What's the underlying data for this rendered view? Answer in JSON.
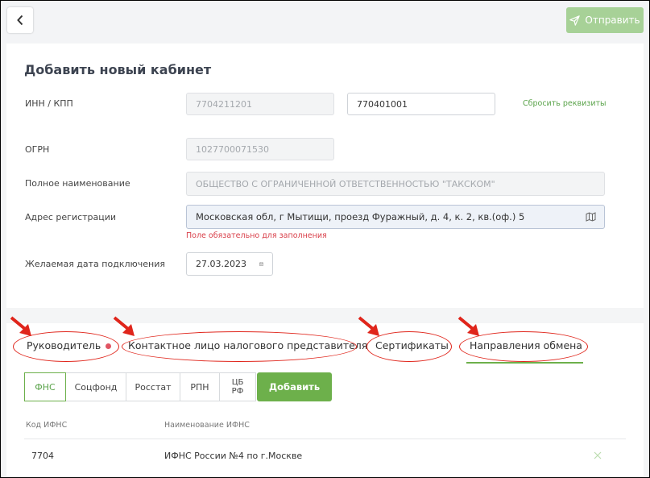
{
  "header": {
    "back_icon": "chevron-left-icon",
    "send_label": "Отправить",
    "send_icon": "paper-plane-icon"
  },
  "form": {
    "title": "Добавить новый кабинет",
    "inn_kpp": {
      "label": "ИНН / КПП",
      "inn_value": "7704211201",
      "kpp_value": "770401001"
    },
    "reset_link": "Сбросить реквизиты",
    "ogrn": {
      "label": "ОГРН",
      "value": "1027700071530"
    },
    "full_name": {
      "label": "Полное наименование",
      "value": "ОБЩЕСТВО С ОГРАНИЧЕННОЙ ОТВЕТСТВЕННОСТЬЮ \"ТАКСКОМ\""
    },
    "address": {
      "label": "Адрес регистрации",
      "value": "Московская обл, г Мытищи, проезд Фуражный, д. 4, к. 2, кв.(оф.) 5",
      "error": "Поле обязательно для заполнения",
      "icon": "map-icon"
    },
    "date": {
      "label": "Желаемая дата подключения",
      "value": "27.03.2023",
      "icon": "calendar-icon"
    }
  },
  "tabs": [
    {
      "label": "Руководитель",
      "has_dot": true
    },
    {
      "label": "Контактное лицо налогового представителя"
    },
    {
      "label": "Сертификаты"
    },
    {
      "label": "Направления обмена",
      "active": true
    }
  ],
  "sub_tabs": [
    {
      "label": "ФНС",
      "active": true
    },
    {
      "label": "Соцфонд"
    },
    {
      "label": "Росстат"
    },
    {
      "label": "РПН"
    },
    {
      "label_line1": "ЦБ",
      "label_line2": "РФ"
    }
  ],
  "add_button": "Добавить",
  "table": {
    "headers": [
      "Код ИФНС",
      "Наименование ИФНС"
    ],
    "rows": [
      {
        "code": "7704",
        "name": "ИФНС России №4 по г.Москве",
        "action_icon": "close-icon"
      }
    ]
  },
  "colors": {
    "accent": "#6db04b",
    "send_disabled": "#a7d197",
    "error": "#d9414b",
    "annotation": "#e0251b"
  }
}
